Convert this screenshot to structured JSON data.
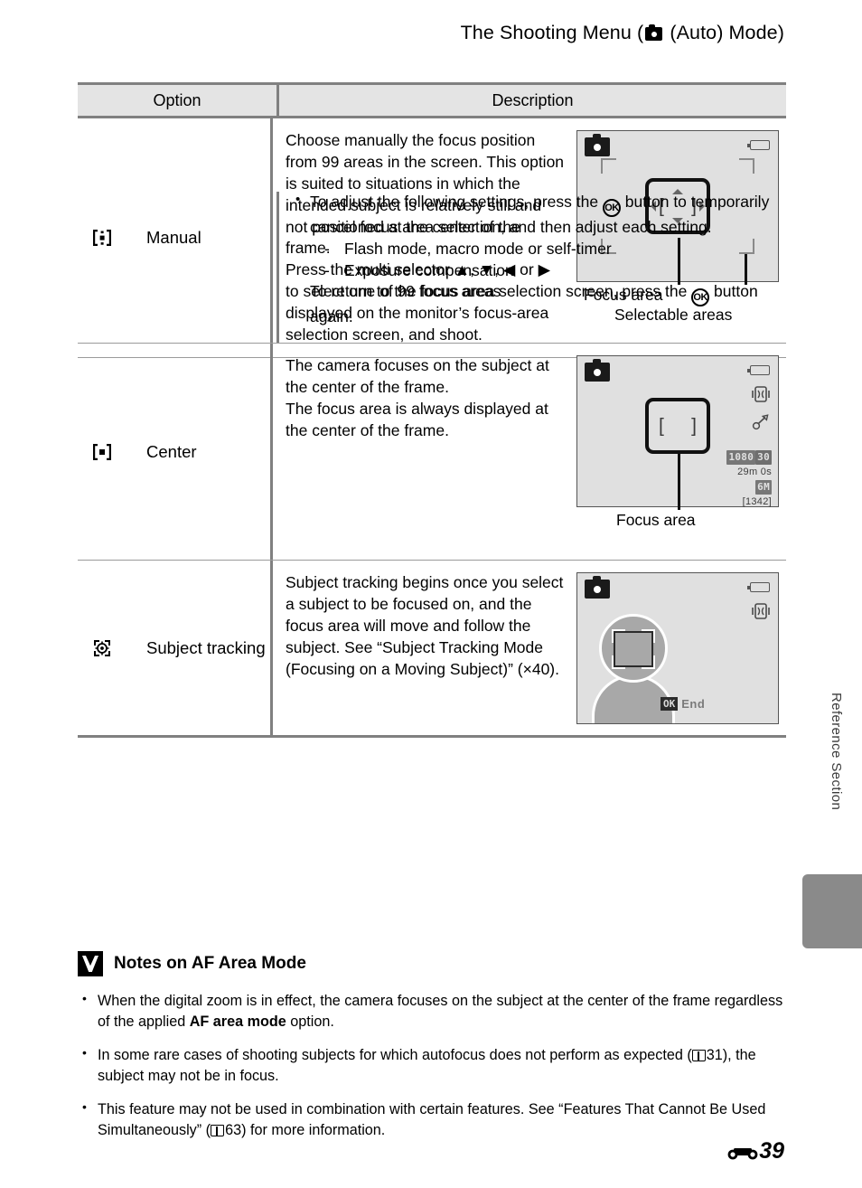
{
  "header": {
    "title_before": "The Shooting Menu (",
    "camera_icon": "camera-auto-icon",
    "title_after": " (Auto) Mode)"
  },
  "table": {
    "columns": [
      "Option",
      "Description"
    ],
    "rows": [
      {
        "icon": "manual-af-area-icon",
        "option": "Manual",
        "paragraphs": [
          "Choose manually the focus position from 99 areas in the screen. This option is suited to situations in which the intended subject is relatively still and not positioned at the center of the frame.",
          "Press the multi selector ▲, ▼, ◀ or ▶ to select one of 99 focus areas displayed on the monitor’s focus-area selection screen, and shoot."
        ],
        "bullets": [
          {
            "text_a": "To adjust the following settings, press the ",
            "ok": "OK",
            "text_b": " button to temporarily cancel focus area selection, and then adjust each setting.",
            "subitems": [
              "Flash mode, macro mode or self-timer",
              "Exposure compensation"
            ],
            "text_c": "To return to the focus area selection screen, press the ",
            "ok2": "OK",
            "text_d": " button again."
          }
        ],
        "illustration": {
          "name": "focus-area-selection-screen",
          "captions": [
            "Focus area",
            "Selectable areas"
          ]
        }
      },
      {
        "icon": "center-af-area-icon",
        "option": "Center",
        "paragraphs": [
          "The camera focuses on the subject at the center of the frame.",
          "The focus area is always displayed at the center of the frame."
        ],
        "illustration": {
          "name": "center-focus-screen",
          "captions": [
            "Focus area"
          ],
          "osd": {
            "movie_size": "1080",
            "frame_rate": "30",
            "record_time": "29m 0s",
            "image_size": "6M",
            "shots_remaining": "[1342]"
          }
        }
      },
      {
        "icon": "subject-tracking-icon",
        "option": "Subject tracking",
        "paragraphs": [
          "Subject tracking begins once you select a subject to be focused on, and the focus area will move and follow the subject. See “Subject Tracking Mode (Focusing on a Moving Subject)” (\u0001×40)."
        ],
        "illustration": {
          "name": "subject-tracking-screen",
          "end_button": "OK",
          "end_label": "End"
        }
      }
    ]
  },
  "notes": {
    "title": "Notes on AF Area Mode",
    "items": [
      {
        "a": "When the digital zoom is in effect, the camera focuses on the subject at the center of the frame regardless of the applied ",
        "bold": "AF area mode",
        "b": " option."
      },
      {
        "a": "In some rare cases of shooting subjects for which autofocus does not perform as expected (",
        "ref": "31",
        "b": "), the subject may not be in focus."
      },
      {
        "a": "This feature may not be used in combination with certain features. See “Features That Cannot Be Used Simultaneously” (",
        "ref": "63",
        "b": ") for more information."
      }
    ]
  },
  "side_tab": {
    "label": "Reference Section"
  },
  "footer": {
    "page": "39",
    "section_symbol": "E"
  }
}
